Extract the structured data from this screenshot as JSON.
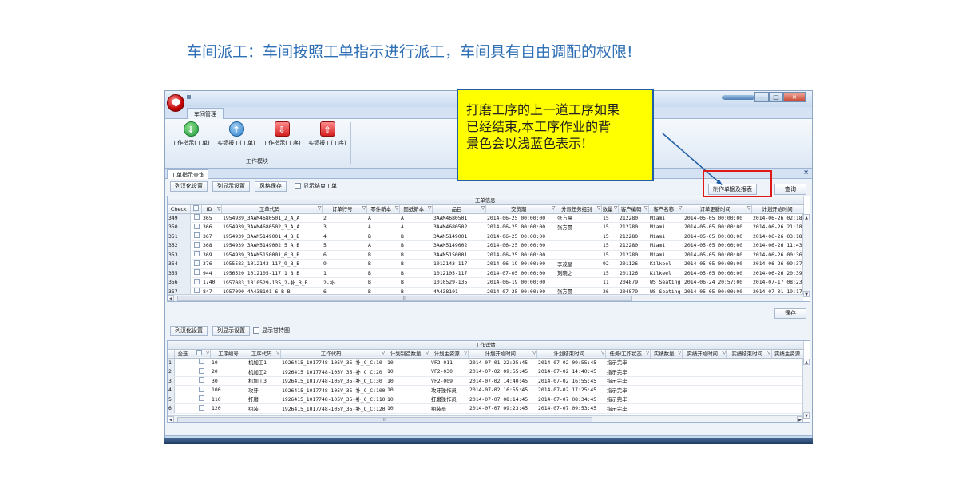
{
  "slide_title": "车间派工：车间按照工单指示进行派工，车间具有自由调配的权限!",
  "app": {
    "ribbon_tab": "车间管理",
    "ribbon_buttons": [
      {
        "label": "工作指示(工单)",
        "icon": "arrow-down-green-icon"
      },
      {
        "label": "实绩报工(工单)",
        "icon": "arrow-up-blue-icon"
      },
      {
        "label": "工作指示(工序)",
        "icon": "arrow-down-red-icon"
      },
      {
        "label": "实绩报工(工序)",
        "icon": "arrow-up-red-icon"
      }
    ],
    "ribbon_group_label": "工作模块",
    "document_tab": "工单指示查询",
    "window_close": "×",
    "top_toolbar": {
      "btn_columns": "列汉化设置",
      "btn_display": "列显示设置",
      "btn_style": "风格保存",
      "chk_show_finished": "显示结束工单",
      "btn_make_report": "制作单据及报表",
      "btn_query": "查询"
    },
    "top_grid": {
      "caption": "工单信息",
      "headers": [
        "Check",
        "ID",
        "工单代码",
        "订单行号",
        "零件新本",
        "图纸新本",
        "品目",
        "交货期",
        "分派任务组别",
        "数量",
        "客户编码",
        "客户名称",
        "订单更新时间",
        "计划开始时间"
      ],
      "rows": [
        {
          "rn": "349",
          "id": "365",
          "code": "1954939_3AAM4680501_2_A_A",
          "line": "2",
          "part": "A",
          "draw": "A",
          "item": "3AAM4680501",
          "due": "2014-06-25 00:00:00",
          "group": "张方晨",
          "qty": "15",
          "cust_code": "212280",
          "cust_name": "Miami",
          "updated": "2014-05-05 00:00:00",
          "plan_start": "2014-06-26 02:18"
        },
        {
          "rn": "350",
          "id": "366",
          "code": "1954939_3AAM4680502_3_A_A",
          "line": "3",
          "part": "A",
          "draw": "A",
          "item": "3AAM4680502",
          "due": "2014-06-25 00:00:00",
          "group": "张方晨",
          "qty": "15",
          "cust_code": "212280",
          "cust_name": "Miami",
          "updated": "2014-05-05 00:00:00",
          "plan_start": "2014-06-26 21:18"
        },
        {
          "rn": "351",
          "id": "367",
          "code": "1954939_3AAM5149001_4_B_B",
          "line": "4",
          "part": "B",
          "draw": "B",
          "item": "3AAM5149001",
          "due": "2014-06-25 00:00:00",
          "group": "",
          "qty": "15",
          "cust_code": "212280",
          "cust_name": "Miami",
          "updated": "2014-05-05 00:00:00",
          "plan_start": "2014-06-26 03:18"
        },
        {
          "rn": "352",
          "id": "368",
          "code": "1954939_3AAM5149002_5_A_B",
          "line": "5",
          "part": "A",
          "draw": "B",
          "item": "3AAM5149002",
          "due": "2014-06-25 00:00:00",
          "group": "",
          "qty": "15",
          "cust_code": "212280",
          "cust_name": "Miami",
          "updated": "2014-05-05 00:00:00",
          "plan_start": "2014-06-26 11:43"
        },
        {
          "rn": "353",
          "id": "369",
          "code": "1954939_3AAM5150001_6_B_B",
          "line": "6",
          "part": "B",
          "draw": "B",
          "item": "3AAM5150001",
          "due": "2014-06-25 00:00:00",
          "group": "",
          "qty": "15",
          "cust_code": "212280",
          "cust_name": "Miami",
          "updated": "2014-05-05 00:00:00",
          "plan_start": "2014-06-26 00:36"
        },
        {
          "rn": "354",
          "id": "376",
          "code": "1955583_1012143-117_9_B_B",
          "line": "9",
          "part": "B",
          "draw": "B",
          "item": "1012143-117",
          "due": "2014-06-19 00:00:00",
          "group": "李茂星",
          "qty": "92",
          "cust_code": "201126",
          "cust_name": "Kilkeel",
          "updated": "2014-05-05 00:00:00",
          "plan_start": "2014-06-26 09:37"
        },
        {
          "rn": "355",
          "id": "944",
          "code": "1956520_1012105-117_1_B_B",
          "line": "1",
          "part": "B",
          "draw": "B",
          "item": "1012105-117",
          "due": "2014-07-05 00:00:00",
          "group": "刘晓之",
          "qty": "15",
          "cust_code": "201126",
          "cust_name": "Kilkeel",
          "updated": "2014-05-05 00:00:00",
          "plan_start": "2014-06-26 20:39"
        },
        {
          "rn": "356",
          "id": "1740",
          "code": "1957083_1010529-135_2-补_B_B",
          "line": "2-补",
          "part": "B",
          "draw": "B",
          "item": "1010529-135",
          "due": "2014-06-19 00:00:00",
          "group": "",
          "qty": "11",
          "cust_code": "204879",
          "cust_name": "WS Seating",
          "updated": "2014-06-24 20:57:00",
          "plan_start": "2014-07-17 08:23"
        },
        {
          "rn": "357",
          "id": "847",
          "code": "1957090_4A438101_6_B_B",
          "line": "6",
          "part": "B",
          "draw": "B",
          "item": "4A438101",
          "due": "2014-07-25 00:00:00",
          "group": "张方晨",
          "qty": "26",
          "cust_code": "204879",
          "cust_name": "WS Seating",
          "updated": "2014-05-05 00:00:00",
          "plan_start": "2014-07-01 19:17"
        }
      ]
    },
    "save_button": "保存",
    "bottom_toolbar": {
      "btn_columns": "列汉化设置",
      "btn_display": "列显示设置",
      "chk_gantt": "显示甘特图"
    },
    "bottom_grid": {
      "caption": "工作详情",
      "headers": [
        "全选",
        "工序编号",
        "工序代码",
        "工作代码",
        "计划制造数量",
        "计划主资源",
        "计划开始时间",
        "计划结束时间",
        "任务/工作状态",
        "实绩数量",
        "实绩开始时间",
        "实绩结束时间",
        "实绩主资源"
      ],
      "rows": [
        {
          "rn": "1",
          "seq": "10",
          "op": "机加工1",
          "code": "1926415_1017748-105V_35-补_C_C:10",
          "qty": "10",
          "res": "VF2-011",
          "start": "2014-07-01 22:25:45",
          "end": "2014-07-02 09:55:45",
          "status": "指示完毕"
        },
        {
          "rn": "2",
          "seq": "20",
          "op": "机加工2",
          "code": "1926415_1017748-105V_35-补_C_C:20",
          "qty": "10",
          "res": "VF2-030",
          "start": "2014-07-02 09:55:45",
          "end": "2014-07-02 14:40:45",
          "status": "指示完毕"
        },
        {
          "rn": "3",
          "seq": "30",
          "op": "机加工3",
          "code": "1926415_1017748-105V_35-补_C_C:30",
          "qty": "10",
          "res": "VF2-009",
          "start": "2014-07-02 14:40:45",
          "end": "2014-07-02 16:55:45",
          "status": "指示完毕"
        },
        {
          "rn": "4",
          "seq": "100",
          "op": "攻牙",
          "code": "1926415_1017748-105V_35-补_C_C:100",
          "qty": "10",
          "res": "攻牙操作员",
          "start": "2014-07-02 16:55:45",
          "end": "2014-07-02 17:25:45",
          "status": "指示完毕"
        },
        {
          "rn": "5",
          "seq": "110",
          "op": "打磨",
          "code": "1926415_1017748-105V_35-补_C_C:110",
          "qty": "10",
          "res": "打磨操作员",
          "start": "2014-07-07 08:14:45",
          "end": "2014-07-07 08:34:45",
          "status": "指示完毕"
        },
        {
          "rn": "6",
          "seq": "120",
          "op": "组装",
          "code": "1926415_1017748-105V_35-补_C_C:120",
          "qty": "10",
          "res": "组装员",
          "start": "2014-07-07 09:23:45",
          "end": "2014-07-07 09:53:45",
          "status": "指示完毕"
        }
      ]
    },
    "scroll_mark": "III"
  },
  "callout": {
    "line1": "打磨工序的上一道工序如果",
    "line2": "已经结束,本工序作业的背",
    "line3": "景色会以浅蓝色表示!"
  },
  "colors": {
    "title_blue": "#2f6fb5",
    "callout_yellow": "#ffff00",
    "highlight_red": "#e01818",
    "row_blue": "#dcebfa"
  }
}
